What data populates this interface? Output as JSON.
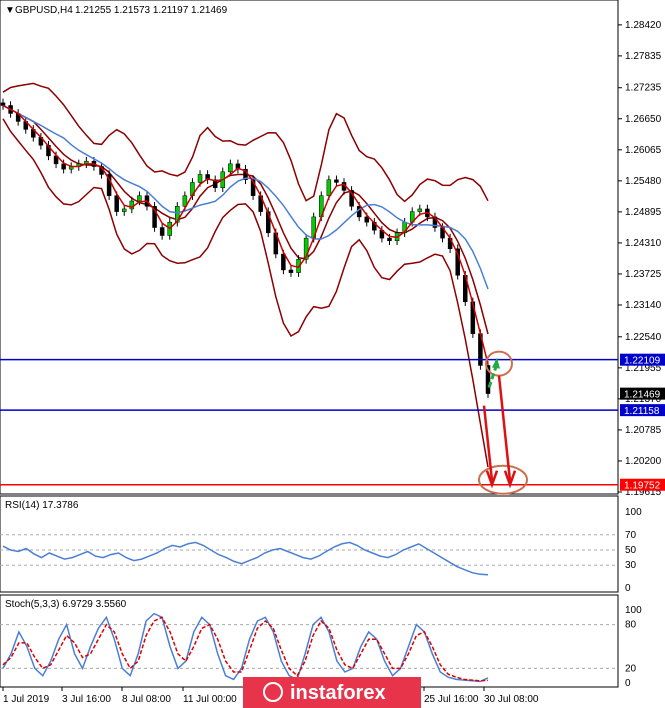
{
  "chart_data": [
    {
      "type": "candlestick",
      "symbol_header": "GBPUSD,H4",
      "ohlc_readout": "1.21255 1.21573 1.21197 1.21469",
      "price_axis_ticks": [
        "1.28420",
        "1.27835",
        "1.27235",
        "1.26650",
        "1.26065",
        "1.25480",
        "1.24895",
        "1.24310",
        "1.23725",
        "1.23140",
        "1.22540",
        "1.21955",
        "1.21370",
        "1.20785",
        "1.20200",
        "1.19615"
      ],
      "ylim": [
        1.19615,
        1.287
      ],
      "close_series": [
        1.269,
        1.2675,
        1.266,
        1.2645,
        1.263,
        1.2615,
        1.2595,
        1.258,
        1.257,
        1.2575,
        1.258,
        1.2585,
        1.2575,
        1.256,
        1.252,
        1.249,
        1.2495,
        1.251,
        1.252,
        1.25,
        1.246,
        1.2445,
        1.247,
        1.25,
        1.252,
        1.2545,
        1.256,
        1.255,
        1.2535,
        1.2565,
        1.258,
        1.257,
        1.255,
        1.252,
        1.249,
        1.245,
        1.241,
        1.238,
        1.2375,
        1.24,
        1.244,
        1.248,
        1.252,
        1.255,
        1.2545,
        1.253,
        1.25,
        1.248,
        1.247,
        1.2455,
        1.244,
        1.2435,
        1.245,
        1.247,
        1.249,
        1.2495,
        1.248,
        1.246,
        1.244,
        1.242,
        1.237,
        1.232,
        1.226,
        1.22,
        1.2147
      ],
      "horizontal_levels": [
        {
          "label": "1.22109",
          "value": 1.22109,
          "color": "#0000cc"
        },
        {
          "label": "1.21158",
          "value": 1.21158,
          "color": "#0000cc"
        },
        {
          "label": "1.19752",
          "value": 1.19752,
          "color": "#ff0000"
        }
      ],
      "current_price_label": "1.21469",
      "annotations": [
        "up arrow toward 1.22109",
        "down arrows toward 1.19752"
      ]
    },
    {
      "type": "line",
      "header": "RSI(14) 17.3786",
      "y_ticks": [
        "100",
        "70",
        "50",
        "30",
        "0"
      ],
      "ylim": [
        0,
        100
      ],
      "values": [
        55,
        50,
        48,
        52,
        45,
        40,
        46,
        42,
        38,
        40,
        44,
        48,
        42,
        40,
        44,
        46,
        40,
        36,
        38,
        42,
        46,
        52,
        56,
        54,
        58,
        60,
        56,
        50,
        44,
        40,
        35,
        32,
        36,
        40,
        46,
        50,
        52,
        48,
        44,
        40,
        38,
        42,
        48,
        54,
        58,
        60,
        56,
        50,
        46,
        42,
        40,
        44,
        50,
        54,
        58,
        52,
        46,
        40,
        34,
        28,
        24,
        20,
        18,
        17.4
      ]
    },
    {
      "type": "line",
      "header": "Stoch(5,3,3) 6.9729 3.5560",
      "y_ticks": [
        "100",
        "80",
        "20",
        "0"
      ],
      "ylim": [
        0,
        100
      ],
      "main": [
        20,
        40,
        70,
        50,
        20,
        10,
        30,
        60,
        80,
        40,
        20,
        50,
        75,
        90,
        60,
        20,
        10,
        40,
        85,
        95,
        90,
        50,
        20,
        30,
        70,
        90,
        80,
        40,
        10,
        5,
        20,
        60,
        85,
        90,
        70,
        30,
        10,
        5,
        40,
        80,
        90,
        70,
        30,
        15,
        20,
        50,
        70,
        60,
        30,
        10,
        20,
        50,
        80,
        70,
        40,
        15,
        8,
        5,
        4,
        3,
        2,
        7
      ],
      "signal": [
        25,
        35,
        55,
        55,
        35,
        20,
        25,
        45,
        65,
        55,
        35,
        40,
        60,
        80,
        70,
        40,
        20,
        30,
        65,
        85,
        90,
        70,
        40,
        30,
        50,
        75,
        80,
        60,
        30,
        15,
        15,
        45,
        75,
        85,
        75,
        45,
        20,
        10,
        30,
        65,
        85,
        75,
        45,
        25,
        20,
        40,
        60,
        60,
        40,
        20,
        20,
        40,
        65,
        70,
        50,
        25,
        12,
        8,
        5,
        4,
        3,
        3.6
      ]
    }
  ],
  "time_axis": [
    "1 Jul 2019",
    "3 Jul 16:00",
    "8 Jul 08:00",
    "11 Jul 00:00",
    "25 Jul 16:00",
    "30 Jul 08:00"
  ],
  "watermark": "instaforex",
  "colors": {
    "bollinger": "#8b0000",
    "fast_ma": "#cc0000",
    "slow_ma": "#4a7fd4",
    "rsi": "#4a7fd4",
    "stoch_main": "#4a7fd4",
    "stoch_signal": "#dd0000",
    "level_blue": "#0000cc",
    "level_red": "#ff0000",
    "watermark_bg": "#e8344a"
  }
}
